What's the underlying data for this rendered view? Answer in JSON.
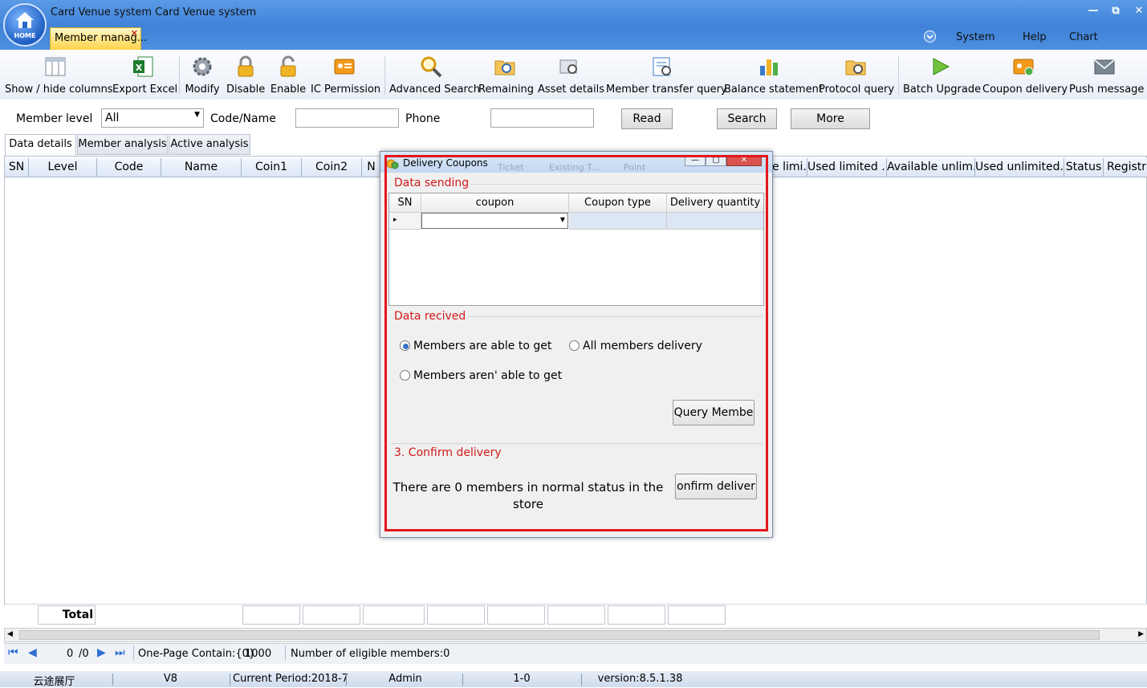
{
  "window": {
    "title": "Card Venue system Card Venue system",
    "logo_text": "HOME",
    "controls": [
      "—",
      "⧉",
      "✕"
    ]
  },
  "tab": {
    "label": "Member manag...",
    "close": "✕"
  },
  "top_menu": {
    "system": "System",
    "help": "Help",
    "chart": "Chart"
  },
  "toolbar": [
    {
      "label": "Show / hide columns",
      "icon": "columns-icon"
    },
    {
      "label": "Export Excel",
      "icon": "excel-icon"
    },
    {
      "label": "Modify",
      "icon": "gear-icon"
    },
    {
      "label": "Disable",
      "icon": "lock-icon"
    },
    {
      "label": "Enable",
      "icon": "unlock-icon"
    },
    {
      "label": "IC Permission",
      "icon": "ic-card-icon"
    },
    {
      "label": "Advanced Search",
      "icon": "magnifier-icon"
    },
    {
      "label": "Remaining",
      "icon": "folder-search-icon"
    },
    {
      "label": "Asset details",
      "icon": "asset-icon"
    },
    {
      "label": "Member transfer query",
      "icon": "transfer-icon"
    },
    {
      "label": "Balance statement",
      "icon": "bar-chart-icon"
    },
    {
      "label": "Protocol query",
      "icon": "protocol-icon"
    },
    {
      "label": "Batch Upgrade",
      "icon": "play-icon"
    },
    {
      "label": "Coupon delivery",
      "icon": "coupon-icon"
    },
    {
      "label": "Push message",
      "icon": "mail-icon"
    }
  ],
  "filters": {
    "member_level_label": "Member level",
    "member_level_value": "All",
    "code_name_label": "Code/Name",
    "code_name_value": "",
    "phone_label": "Phone",
    "phone_value": "",
    "read_button": "Read",
    "search_button": "Search",
    "more_button": "More"
  },
  "page_tabs": [
    "Data details",
    "Member analysis",
    "Active analysis"
  ],
  "grid": {
    "columns_left": [
      "SN",
      "Level",
      "Code",
      "Name",
      "Coin1",
      "Coin2",
      "N"
    ],
    "columns_right": [
      "e limi...",
      "Used limited ...",
      "Available unlim...",
      "Used unlimited...",
      "Status",
      "Registra"
    ],
    "total_label": "Total"
  },
  "pager": {
    "page_value": "0",
    "page_total": "/0",
    "page_size_label": "One-Page Contain:{0}",
    "page_size_value": "1000",
    "eligible_label": "Number of eligible members:0"
  },
  "status_bar": {
    "venue": "云途展厅",
    "version_short": "V8",
    "period": "Current Period:2018-7",
    "user": "Admin",
    "code": "1-0",
    "version": "version:8.5.1.38"
  },
  "dialog": {
    "title": "Delivery Coupons",
    "controls": [
      "—",
      "▢",
      "✕"
    ],
    "section1_title": "Data sending",
    "coupon_grid_headers": [
      "SN",
      "coupon",
      "Coupon type",
      "Delivery quantity"
    ],
    "row_pointer": "▸",
    "section2_title": "Data recived",
    "radio_able": "Members are able to get",
    "radio_all": "All members delivery",
    "radio_not_able": "Members aren' able to get",
    "selected_radio": "Members are able to get",
    "query_button": "Query Membe",
    "section3_title": "3. Confirm delivery",
    "confirm_text": "There are 0 members in normal status in the store",
    "confirm_button": "onfirm deliver",
    "behind_text": [
      "Ticket",
      "Existing T...",
      "Point"
    ]
  },
  "colors": {
    "title_bar": "#4a8ddf",
    "active_tab": "#ffd44a",
    "dialog_highlight": "#e3161b",
    "section_title": "#d21a1a"
  }
}
